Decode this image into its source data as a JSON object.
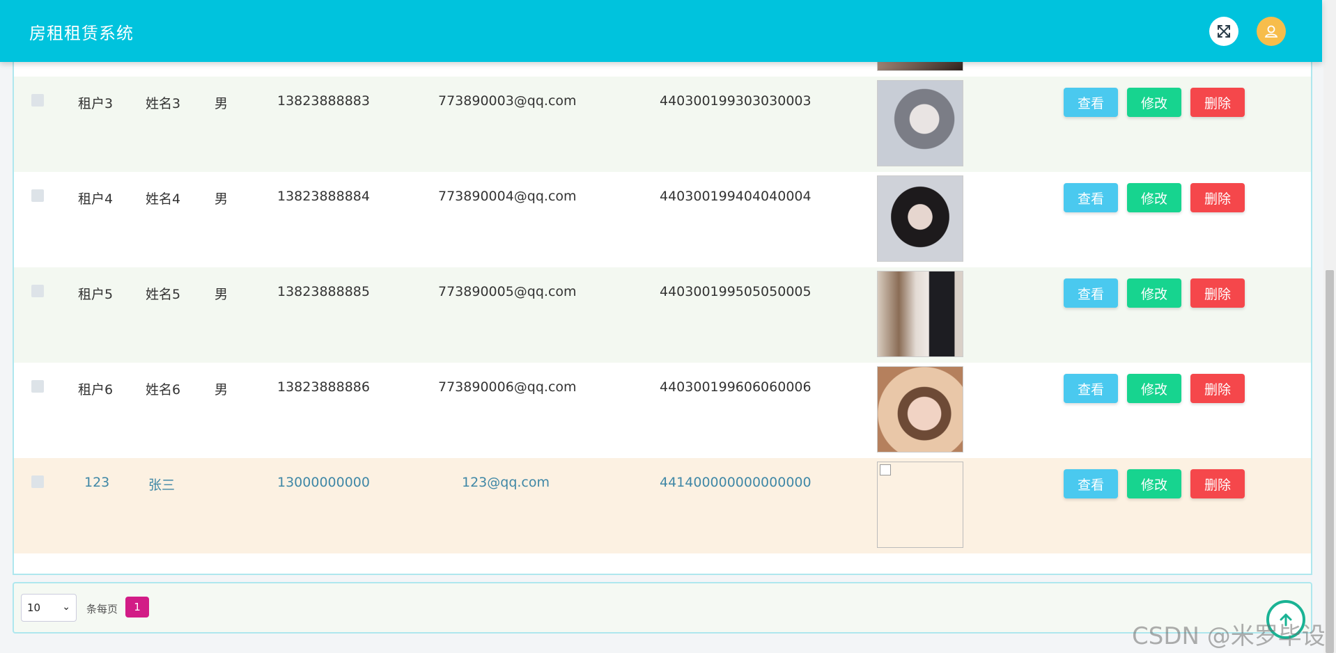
{
  "header": {
    "title": "房租租赁系统",
    "bg_color": "#00c3dd",
    "icons": [
      "fullscreen-icon",
      "user-icon"
    ]
  },
  "table": {
    "rows": [
      {
        "account": "",
        "name": "",
        "gender": "",
        "phone": "",
        "email": "",
        "id_card": "",
        "photo": "girl-hand",
        "highlight": false,
        "alt": false
      },
      {
        "account": "租户3",
        "name": "姓名3",
        "gender": "男",
        "phone": "13823888883",
        "email": "773890003@qq.com",
        "id_card": "440300199303030003",
        "photo": "girl-silver-hair",
        "highlight": false,
        "alt": true
      },
      {
        "account": "租户4",
        "name": "姓名4",
        "gender": "男",
        "phone": "13823888884",
        "email": "773890004@qq.com",
        "id_card": "440300199404040004",
        "photo": "girl-dark-hair",
        "highlight": false,
        "alt": false
      },
      {
        "account": "租户5",
        "name": "姓名5",
        "gender": "男",
        "phone": "13823888885",
        "email": "773890005@qq.com",
        "id_card": "440300199505050005",
        "photo": "boy-back",
        "highlight": false,
        "alt": true
      },
      {
        "account": "租户6",
        "name": "姓名6",
        "gender": "男",
        "phone": "13823888886",
        "email": "773890006@qq.com",
        "id_card": "440300199606060006",
        "photo": "girl-glasses",
        "highlight": false,
        "alt": false
      },
      {
        "account": "123",
        "name": "张三",
        "gender": "",
        "phone": "13000000000",
        "email": "123@qq.com",
        "id_card": "441400000000000000",
        "photo": "broken",
        "highlight": true,
        "alt": false
      }
    ],
    "actions": {
      "view": "查看",
      "edit": "修改",
      "delete": "删除"
    },
    "colors": {
      "view": "#4ac9ef",
      "edit": "#17d48f",
      "delete": "#f5474b"
    }
  },
  "pagination": {
    "page_size": "10",
    "per_page_label": "条每页",
    "current_page": "1"
  },
  "watermark": "CSDN @米罗毕设"
}
